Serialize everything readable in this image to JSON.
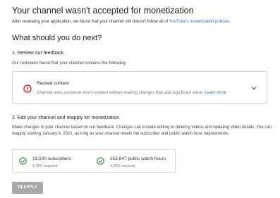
{
  "header": {
    "title": "Your channel wasn't accepted for monetization",
    "intro_text": "After reviewing your application, we found that your channel still doesn't follow all of ",
    "intro_link": "YouTube's monetization policies",
    "intro_end": "."
  },
  "next": {
    "heading": "What should you do next?"
  },
  "step1": {
    "heading": "1. Review our feedback",
    "note": "Our reviewers found that your channel contains the following:",
    "card": {
      "title": "Reused content",
      "description": "Channel uses someone else's content without making changes that add significant value.",
      "link": "Learn more",
      "icon": "alert-circle-icon",
      "icon_color": "#cc0000"
    }
  },
  "step2": {
    "heading": "2. Edit your channel and reapply for monetization",
    "paragraph": "Make changes to your channel based on our feedback. Changes can include editing or deleting videos and updating video details. You can reapply starting January 6, 2021, as long as your channel meets the subscriber and public watch hour requirements.",
    "requirements": [
      {
        "value": "19,500 subscribers",
        "required": "1,000 required",
        "icon": "check-circle-icon"
      },
      {
        "value": "253,847 public watch hours",
        "required": "4,000 required",
        "icon": "check-circle-icon"
      }
    ],
    "check_color": "#2e8b3a"
  },
  "actions": {
    "reapply_label": "REAPPLY"
  }
}
